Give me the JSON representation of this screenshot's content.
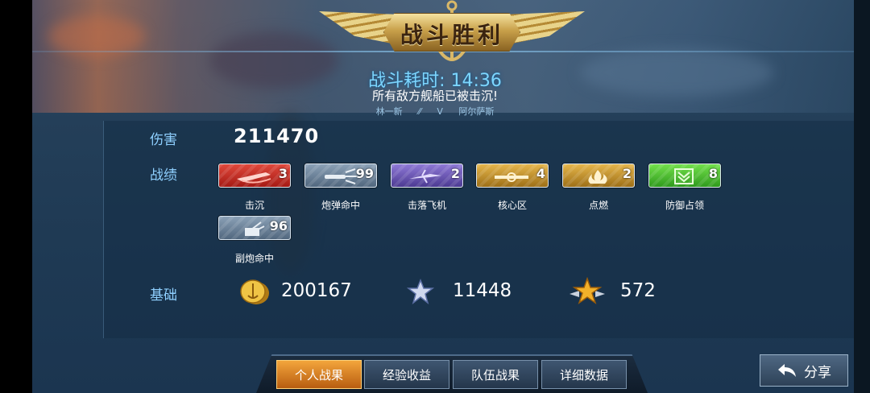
{
  "header": {
    "title": "战斗胜利",
    "time_label": "战斗耗时: 14:36",
    "subtitle": "所有敌方舰船已被击沉!",
    "left_player": "林一新",
    "vs": "V",
    "right_player": "阿尔萨斯"
  },
  "damage": {
    "label": "伤害",
    "value": "211470"
  },
  "achievements": {
    "label": "战绩",
    "items": [
      {
        "label": "击沉",
        "count": "3",
        "color": "red",
        "icon": "sinking-ship-icon"
      },
      {
        "label": "炮弹命中",
        "count": "99",
        "color": "gray",
        "icon": "shell-hit-icon"
      },
      {
        "label": "击落飞机",
        "count": "2",
        "color": "purple",
        "icon": "plane-downed-icon"
      },
      {
        "label": "核心区",
        "count": "4",
        "color": "gold",
        "icon": "core-zone-icon"
      },
      {
        "label": "点燃",
        "count": "2",
        "color": "gold",
        "icon": "fire-icon"
      },
      {
        "label": "防御占领",
        "count": "8",
        "color": "green",
        "icon": "defense-chevron-icon"
      },
      {
        "label": "副炮命中",
        "count": "96",
        "color": "gray",
        "icon": "secondary-gun-icon"
      }
    ]
  },
  "base": {
    "label": "基础",
    "coins": "200167",
    "stars": "11448",
    "winged_star": "572"
  },
  "tabs": [
    "个人战果",
    "经验收益",
    "队伍战果",
    "详细数据"
  ],
  "active_tab": "个人战果",
  "share_label": "分享"
}
